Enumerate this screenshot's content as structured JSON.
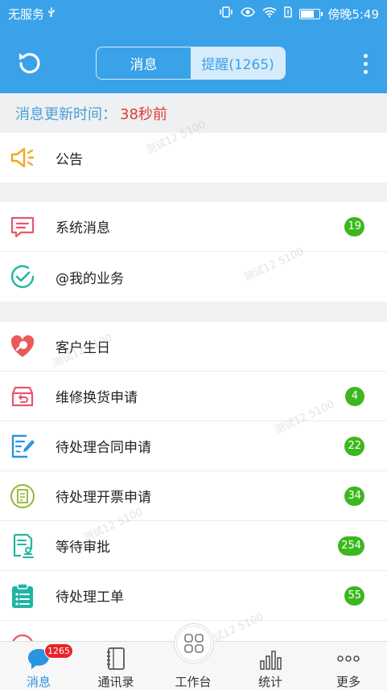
{
  "status_bar": {
    "carrier": "无服务",
    "time": "傍晚5:49"
  },
  "header": {
    "tabs": [
      {
        "label": "消息",
        "active": false
      },
      {
        "label": "提醒(1265)",
        "active": true
      }
    ],
    "icons": {
      "left": "refresh-icon",
      "right": "more-vertical-icon"
    }
  },
  "update": {
    "label": "消息更新时间：",
    "value": "38秒前"
  },
  "sections": [
    {
      "items": [
        {
          "label": "公告",
          "icon": "megaphone-icon",
          "color": "#f0a81e"
        }
      ]
    },
    {
      "items": [
        {
          "label": "系统消息",
          "icon": "chat-bubble-icon",
          "color": "#e8566b",
          "count": "19"
        },
        {
          "label": "@我的业务",
          "icon": "check-circle-icon",
          "color": "#1fb5a3"
        }
      ]
    },
    {
      "items": [
        {
          "label": "客户生日",
          "icon": "heart-icon",
          "color": "#ea5a5a"
        },
        {
          "label": "维修换货申请",
          "icon": "return-box-icon",
          "color": "#e8566b",
          "count": "4"
        },
        {
          "label": "待处理合同申请",
          "icon": "contract-edit-icon",
          "color": "#2a94e0",
          "count": "22"
        },
        {
          "label": "待处理开票申请",
          "icon": "invoice-icon",
          "color": "#97b52e",
          "count": "34"
        },
        {
          "label": "等待审批",
          "icon": "approval-stamp-icon",
          "color": "#23b59b",
          "count": "254"
        },
        {
          "label": "待处理工单",
          "icon": "clipboard-list-icon",
          "color": "#1fb5a3",
          "count": "55"
        }
      ]
    }
  ],
  "watermark": "测试12 5100",
  "tabbar": {
    "tabs": [
      {
        "label": "消息",
        "icon": "message-icon",
        "active": true,
        "badge": "1265"
      },
      {
        "label": "通讯录",
        "icon": "contacts-book-icon",
        "active": false
      },
      {
        "label": "工作台",
        "icon": "workbench-grid-icon",
        "active": false
      },
      {
        "label": "统计",
        "icon": "bar-stats-icon",
        "active": false
      },
      {
        "label": "更多",
        "icon": "more-dots-icon",
        "active": false
      }
    ]
  },
  "colors": {
    "primary": "#3aa2e8",
    "badge_green": "#3cb81e",
    "badge_red": "#e8242a",
    "time_red": "#e03a3a"
  }
}
